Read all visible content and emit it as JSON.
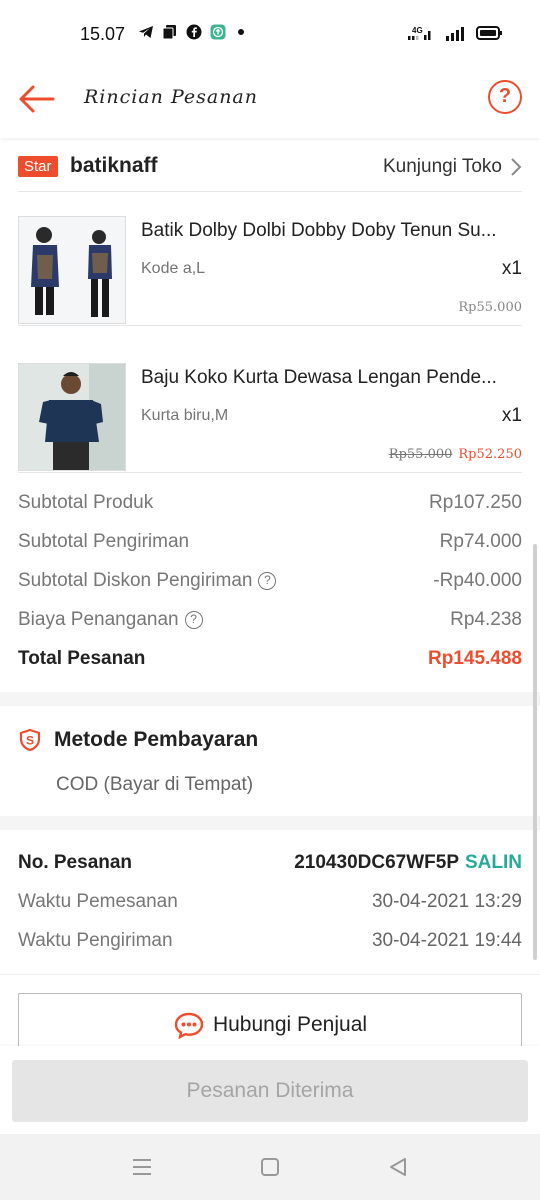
{
  "status_bar": {
    "time": "15.07",
    "network": "4G"
  },
  "header": {
    "title": "Rincian Pesanan",
    "help_symbol": "?"
  },
  "shop": {
    "badge": "Star",
    "name": "batiknaff",
    "visit_label": "Kunjungi Toko"
  },
  "items": [
    {
      "name": "Batik Dolby Dolbi Dobby Doby Tenun Su...",
      "variant": "Kode a,L",
      "qty": "x1",
      "price": "Rp55.000"
    },
    {
      "name": "Baju Koko Kurta Dewasa Lengan Pende...",
      "variant": "Kurta biru,M",
      "qty": "x1",
      "price_original": "Rp55.000",
      "price": "Rp52.250"
    }
  ],
  "summary": {
    "subtotal_produk_label": "Subtotal Produk",
    "subtotal_produk": "Rp107.250",
    "subtotal_pengiriman_label": "Subtotal Pengiriman",
    "subtotal_pengiriman": "Rp74.000",
    "diskon_label": "Subtotal Diskon Pengiriman",
    "diskon": "-Rp40.000",
    "biaya_label": "Biaya Penanganan",
    "biaya": "Rp4.238",
    "total_label": "Total Pesanan",
    "total": "Rp145.488"
  },
  "payment": {
    "title": "Metode Pembayaran",
    "method": "COD (Bayar di Tempat)"
  },
  "order": {
    "no_label": "No. Pesanan",
    "no_value": "210430DC67WF5P",
    "copy_label": "SALIN",
    "waktu_pemesanan_label": "Waktu Pemesanan",
    "waktu_pemesanan": "30-04-2021 13:29",
    "waktu_pengiriman_label": "Waktu Pengiriman",
    "waktu_pengiriman": "30-04-2021 19:44"
  },
  "actions": {
    "contact_seller": "Hubungi Penjual",
    "order_received": "Pesanan Diterima"
  },
  "colors": {
    "accent": "#ee4d2d",
    "teal": "#26aa99",
    "disabled": "#e5e5e5"
  },
  "icons": [
    "telegram-icon",
    "copy-icon",
    "facebook-icon",
    "upload-icon",
    "signal-icon",
    "battery-icon",
    "back-arrow-icon",
    "help-icon",
    "chevron-right-icon",
    "shield-payment-icon",
    "chat-icon",
    "menu-icon",
    "home-icon",
    "back-icon"
  ]
}
